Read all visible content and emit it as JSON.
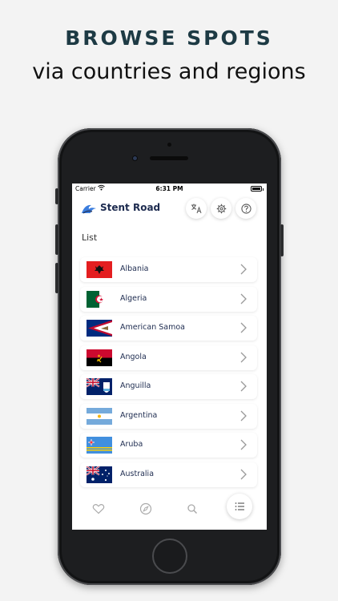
{
  "promo": {
    "headline": "BROWSE SPOTS",
    "subheadline": "via countries and regions"
  },
  "status_bar": {
    "carrier": "Carrier",
    "time": "6:31 PM"
  },
  "app_bar": {
    "title": "Stent Road",
    "icons": [
      "translate-icon",
      "gear-icon",
      "help-icon"
    ]
  },
  "list": {
    "title": "List",
    "items": [
      {
        "label": "Albania",
        "flag": "albania-flag"
      },
      {
        "label": "Algeria",
        "flag": "algeria-flag"
      },
      {
        "label": "American Samoa",
        "flag": "american-samoa-flag"
      },
      {
        "label": "Angola",
        "flag": "angola-flag"
      },
      {
        "label": "Anguilla",
        "flag": "anguilla-flag"
      },
      {
        "label": "Argentina",
        "flag": "argentina-flag"
      },
      {
        "label": "Aruba",
        "flag": "aruba-flag"
      },
      {
        "label": "Australia",
        "flag": "australia-flag"
      }
    ]
  },
  "tab_bar": {
    "tabs": [
      "heart-icon",
      "compass-icon",
      "search-icon",
      "list-icon"
    ],
    "active": "list-icon"
  },
  "colors": {
    "accent": "#3b7ddd",
    "text_dark": "#1d2b4f",
    "background": "#f3f3f3"
  }
}
